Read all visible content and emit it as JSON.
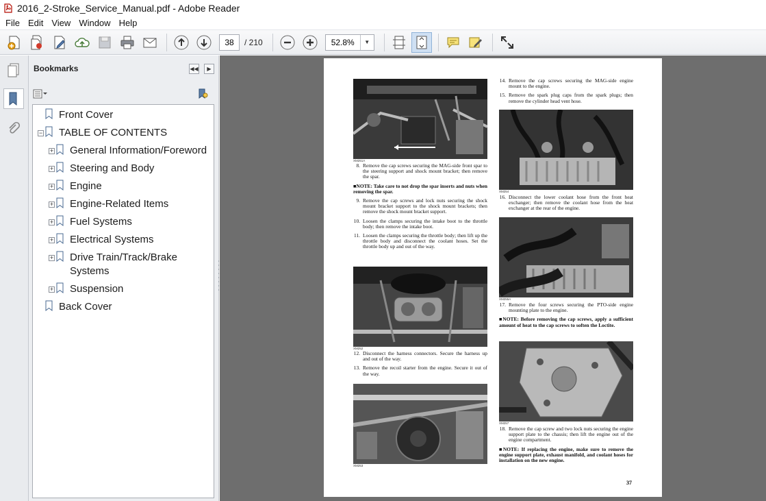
{
  "window": {
    "title": "2016_2-Stroke_Service_Manual.pdf - Adobe Reader"
  },
  "menu": [
    "File",
    "Edit",
    "View",
    "Window",
    "Help"
  ],
  "toolbar": {
    "page_current": "38",
    "page_total": "/ 210",
    "zoom": "52.8%"
  },
  "bookmarks": {
    "title": "Bookmarks",
    "items": [
      {
        "label": "Front Cover"
      },
      {
        "label": "TABLE OF CONTENTS"
      },
      {
        "label": "General Information/Foreword"
      },
      {
        "label": "Steering and Body"
      },
      {
        "label": "Engine"
      },
      {
        "label": "Engine-Related Items"
      },
      {
        "label": "Fuel Systems"
      },
      {
        "label": "Electrical Systems"
      },
      {
        "label": "Drive Train/Track/Brake Systems"
      },
      {
        "label": "Suspension"
      },
      {
        "label": "Back Cover"
      }
    ]
  },
  "document": {
    "page_number": "37",
    "photo_labels": [
      "XM251A",
      "XM252",
      "XM253",
      "XM254",
      "XM255A",
      "XM257"
    ],
    "left_steps": [
      {
        "num": "8.",
        "text": "Remove the cap screws securing the MAG-side front spar to the steering support and shock mount bracket; then remove the spar."
      },
      {
        "num": "9.",
        "text": "Remove the cap screws and lock nuts securing the shock mount bracket support to the shock mount brackets; then remove the shock mount bracket support."
      },
      {
        "num": "10.",
        "text": "Loosen the clamps securing the intake boot to the throttle body; then remove the intake boot."
      },
      {
        "num": "11.",
        "text": "Loosen the clamps securing the throttle body; then lift up the throttle body and disconnect the coolant hoses. Set the throttle body up and out of the way."
      },
      {
        "num": "12.",
        "text": "Disconnect the harness connectors. Secure the harness up and out of the way."
      },
      {
        "num": "13.",
        "text": "Remove the recoil starter from the engine. Secure it out of the way."
      }
    ],
    "left_note": "■NOTE: Take care to not drop the spar inserts and nuts when removing the spar.",
    "right_steps": [
      {
        "num": "14.",
        "text": "Remove the cap screws securing the MAG-side engine mount to the engine."
      },
      {
        "num": "15.",
        "text": "Remove the spark plug caps from the spark plugs; then remove the cylinder head vent hose."
      },
      {
        "num": "16.",
        "text": "Disconnect the lower coolant hose from the front heat exchanger; then remove the coolant hose from the heat exchanger at the rear of the engine."
      },
      {
        "num": "17.",
        "text": "Remove the four screws securing the PTO-side engine mounting plate to the engine."
      },
      {
        "num": "18.",
        "text": "Remove the cap screw and two lock nuts securing the engine support plate to the chassis; then lift the engine out of the engine compartment."
      }
    ],
    "right_note_1": "■NOTE: Before removing the cap screws, apply a sufficient amount of heat to the cap screws to soften the Loctite.",
    "right_note_2": "■NOTE: If replacing the engine, make sure to remove the engine support plate, exhaust manifold, and coolant hoses for installation on the new engine."
  }
}
